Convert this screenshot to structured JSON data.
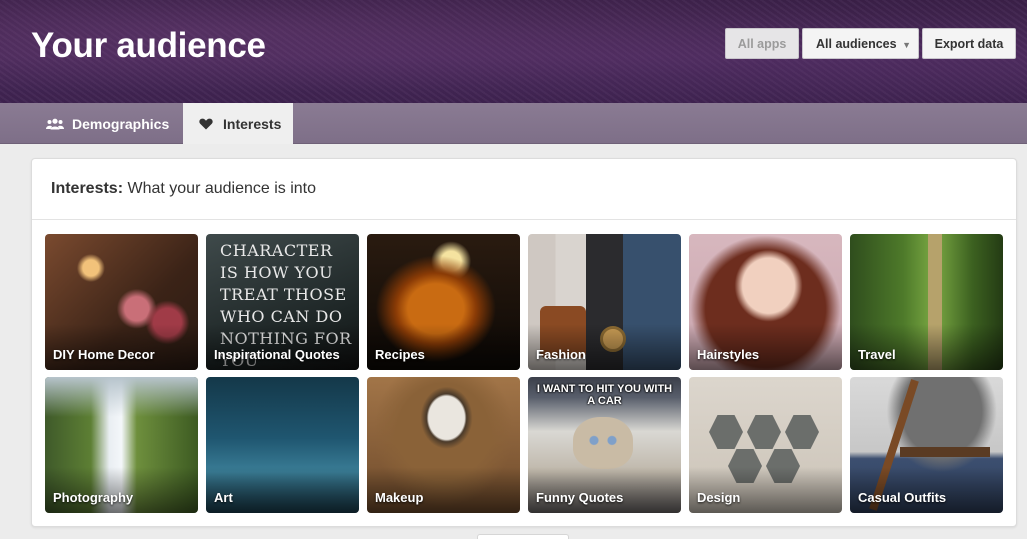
{
  "header": {
    "title": "Your audience",
    "buttons": {
      "all_apps": "All apps",
      "all_audiences": "All audiences",
      "export_data": "Export data"
    }
  },
  "tabs": [
    {
      "label": "Demographics",
      "icon": "users-icon",
      "active": false
    },
    {
      "label": "Interests",
      "icon": "heart-icon",
      "active": true
    }
  ],
  "panel": {
    "title_bold": "Interests:",
    "title_rest": " What your audience is into"
  },
  "interests": [
    {
      "label": "DIY Home Decor"
    },
    {
      "label": "Inspirational Quotes",
      "image_text": "CHARACTER IS HOW YOU TREAT THOSE WHO CAN DO NOTHING FOR YOU"
    },
    {
      "label": "Recipes"
    },
    {
      "label": "Fashion"
    },
    {
      "label": "Hairstyles"
    },
    {
      "label": "Travel"
    },
    {
      "label": "Photography"
    },
    {
      "label": "Art"
    },
    {
      "label": "Makeup"
    },
    {
      "label": "Funny Quotes",
      "image_text": "I WANT TO HIT YOU WITH A CAR"
    },
    {
      "label": "Design"
    },
    {
      "label": "Casual Outfits"
    }
  ],
  "colors": {
    "header_purple": "#3b2049",
    "tabbar_purple": "#7e6f88",
    "active_tab_bg": "#efefef"
  }
}
